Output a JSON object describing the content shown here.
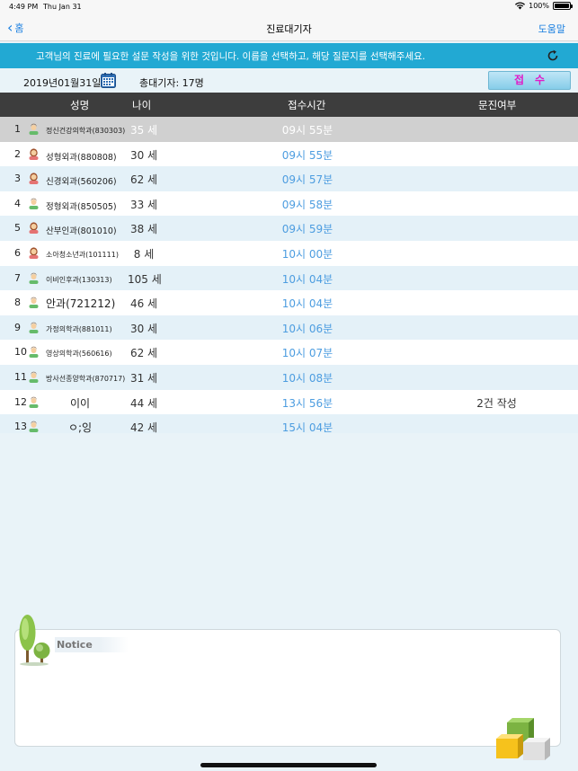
{
  "status_bar": {
    "time": "4:49 PM",
    "date": "Thu Jan 31",
    "battery": "100%"
  },
  "nav": {
    "back_label": "홈",
    "title": "진료대기자",
    "help_label": "도움말"
  },
  "banner": {
    "message": "고객님의 진료에 필요한 설문 작성을 위한 것입니다. 이름을 선택하고, 해당 질문지를 선택해주세요."
  },
  "toolbar": {
    "date": "2019년01월31일",
    "total": "총대기자: 17명",
    "receive_button": "접수"
  },
  "table": {
    "headers": {
      "name": "성명",
      "age": "나이",
      "time": "접수시간",
      "status": "문진여부"
    },
    "rows": [
      {
        "num": "1",
        "name": "정신건강의학과(830303)",
        "age": "35 세",
        "time": "09시 55분",
        "status": "",
        "avatar": "male"
      },
      {
        "num": "2",
        "name": "성형외과(880808)",
        "age": "30 세",
        "time": "09시 55분",
        "status": "",
        "avatar": "female"
      },
      {
        "num": "3",
        "name": "신경외과(560206)",
        "age": "62 세",
        "time": "09시 57분",
        "status": "",
        "avatar": "female"
      },
      {
        "num": "4",
        "name": "정형외과(850505)",
        "age": "33 세",
        "time": "09시 58분",
        "status": "",
        "avatar": "male"
      },
      {
        "num": "5",
        "name": "산부인과(801010)",
        "age": "38 세",
        "time": "09시 59분",
        "status": "",
        "avatar": "female"
      },
      {
        "num": "6",
        "name": "소아청소년과(101111)",
        "age": "8 세",
        "time": "10시 00분",
        "status": "",
        "avatar": "female"
      },
      {
        "num": "7",
        "name": "이비인후과(130313)",
        "age": "105 세",
        "time": "10시 04분",
        "status": "",
        "avatar": "male"
      },
      {
        "num": "8",
        "name": "안과(721212)",
        "age": "46 세",
        "time": "10시 04분",
        "status": "",
        "avatar": "male"
      },
      {
        "num": "9",
        "name": "가정의학과(881011)",
        "age": "30 세",
        "time": "10시 06분",
        "status": "",
        "avatar": "male"
      },
      {
        "num": "10",
        "name": "영상의학과(560616)",
        "age": "62 세",
        "time": "10시 07분",
        "status": "",
        "avatar": "male"
      },
      {
        "num": "11",
        "name": "방사선종양학과(870717)",
        "age": "31 세",
        "time": "10시 08분",
        "status": "",
        "avatar": "male"
      },
      {
        "num": "12",
        "name": "이이",
        "age": "44 세",
        "time": "13시 56분",
        "status": "2건 작성",
        "avatar": "male"
      },
      {
        "num": "13",
        "name": "ㅇ;잉",
        "age": "42 세",
        "time": "15시 04분",
        "status": "",
        "avatar": "male"
      }
    ]
  },
  "notice": {
    "label": "Notice"
  },
  "colors": {
    "banner": "#22a9d3",
    "header": "#3d3d3d",
    "time_text": "#4d9de0",
    "receive_text": "#e01bc8",
    "selected_row": "#d0d0d0"
  }
}
